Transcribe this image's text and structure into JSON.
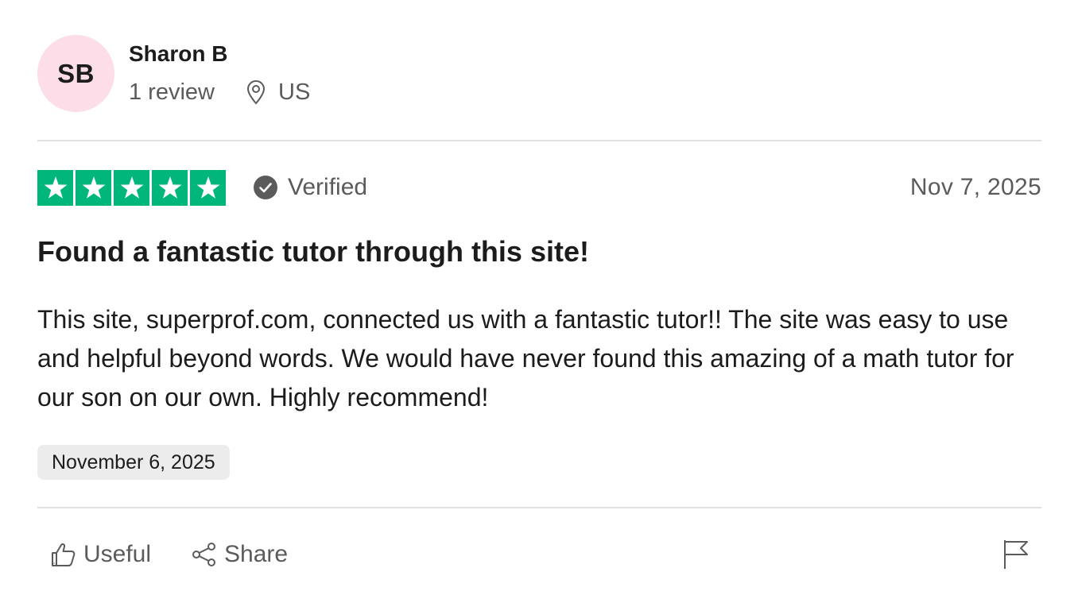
{
  "reviewer": {
    "initials": "SB",
    "name": "Sharon B",
    "review_count": "1 review",
    "country": "US",
    "avatar_color": "#fcdde8"
  },
  "review": {
    "rating": 5,
    "star_color": "#00b67a",
    "verified_label": "Verified",
    "date": "Nov 7, 2025",
    "title": "Found a fantastic tutor through this site!",
    "body": "This site, superprof.com, connected us with a fantastic tutor!! The site was easy to use and helpful beyond words. We would have never found this amazing of a math tutor for our son on our own. Highly recommend!",
    "experience_date": "November 6, 2025"
  },
  "actions": {
    "useful_label": "Useful",
    "share_label": "Share"
  },
  "icons": {
    "location": "location-pin-icon",
    "verified": "check-circle-icon",
    "useful": "thumbs-up-icon",
    "share": "share-icon",
    "report": "flag-icon"
  }
}
